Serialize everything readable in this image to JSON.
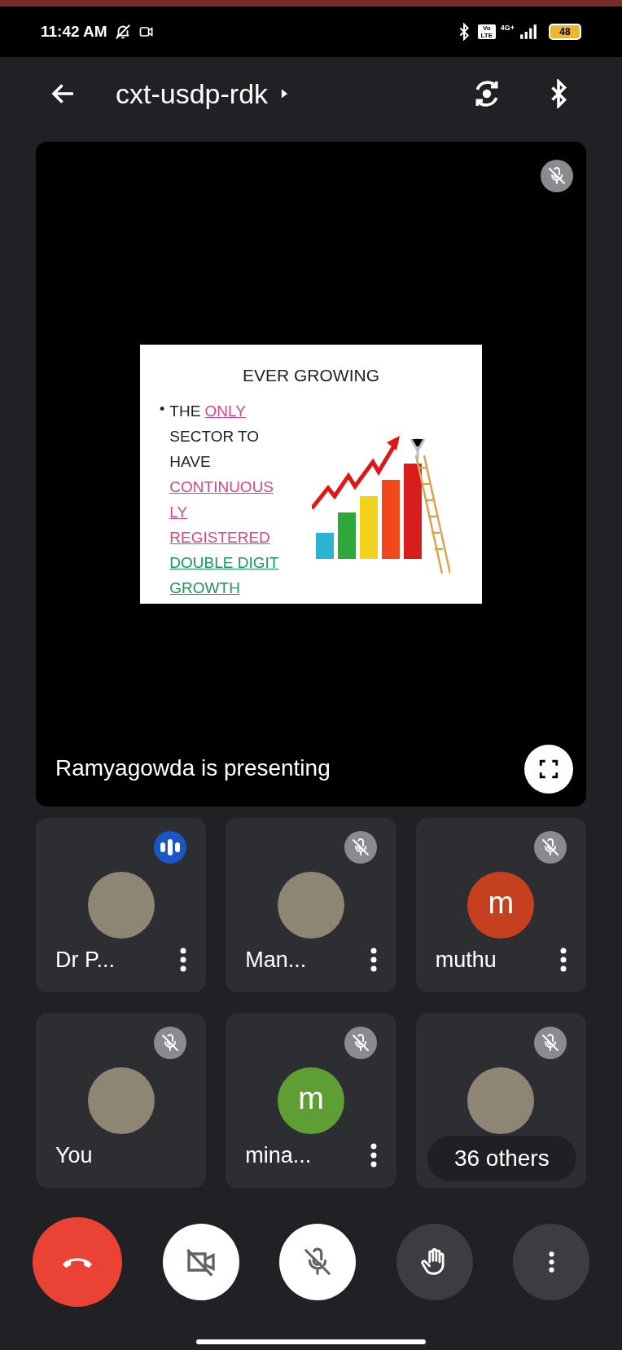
{
  "status_bar": {
    "time": "11:42 AM",
    "volte": "Vo LTE",
    "network": "4G+",
    "battery": "48"
  },
  "header": {
    "title": "cxt-usdp-rdk"
  },
  "presentation": {
    "muted": true,
    "slide": {
      "title": "EVER GROWING",
      "bullet": "•",
      "lines": [
        [
          {
            "text": "THE ",
            "kind": "plain"
          },
          {
            "text": "ONLY",
            "kind": "pink"
          }
        ],
        [
          {
            "text": "SECTOR TO",
            "kind": "plain"
          }
        ],
        [
          {
            "text": "HAVE",
            "kind": "plain"
          }
        ],
        [
          {
            "text": "CONTINUOUS",
            "kind": "pink"
          }
        ],
        [
          {
            "text": "LY",
            "kind": "pink"
          }
        ],
        [
          {
            "text": "REGISTERED",
            "kind": "pink"
          }
        ],
        [
          {
            "text": "DOUBLE DIGIT",
            "kind": "green"
          }
        ],
        [
          {
            "text": "GROWTH",
            "kind": "green"
          }
        ]
      ]
    },
    "caption": "Ramyagowda is presenting"
  },
  "participants": [
    {
      "name": "Dr P...",
      "kind": "photo",
      "speaking": true,
      "menu": true
    },
    {
      "name": "Man...",
      "kind": "photo",
      "speaking": false,
      "menu": true
    },
    {
      "name": "muthu",
      "kind": "initial",
      "initial": "m",
      "color": "#c5401f",
      "speaking": false,
      "menu": true
    },
    {
      "name": "You",
      "kind": "photo",
      "speaking": false,
      "menu": false
    },
    {
      "name": "mina...",
      "kind": "initial",
      "initial": "m",
      "color": "#5f9e35",
      "speaking": false,
      "menu": true
    },
    {
      "kind": "photo",
      "speaking": false,
      "menu": false,
      "others": "36 others"
    }
  ],
  "controls": {
    "camera_on": false,
    "mic_on": false
  }
}
